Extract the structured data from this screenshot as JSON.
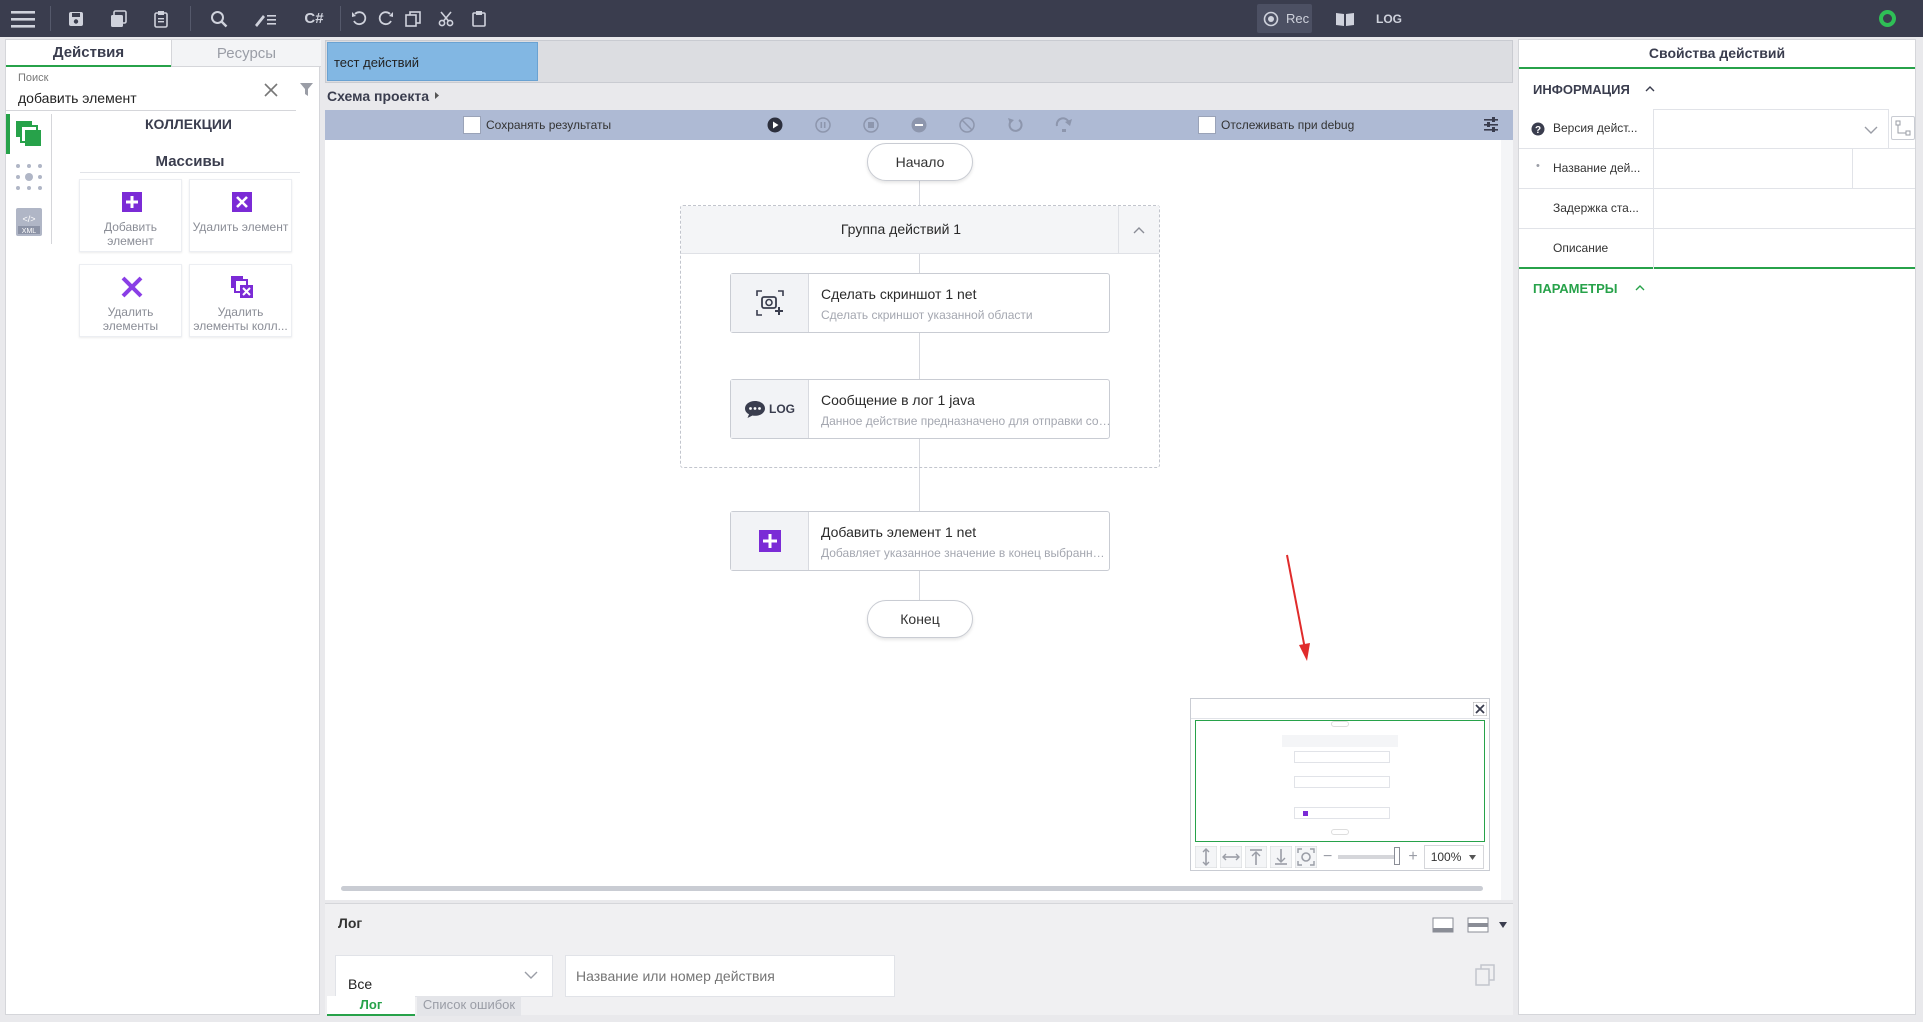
{
  "toolbar": {
    "rec_label": "Rec",
    "log_label": "LOG",
    "csharp_label": "C#"
  },
  "left": {
    "tabs": [
      "Действия",
      "Ресурсы"
    ],
    "search": {
      "label": "Поиск",
      "value": "добавить элемент"
    },
    "section_title": "КОЛЛЕКЦИИ",
    "subsection_title": "Массивы",
    "cards": [
      {
        "label": "Добавить элемент",
        "icon": "add-element-icon"
      },
      {
        "label": "Удалить элемент",
        "icon": "remove-element-icon"
      },
      {
        "label": "Удалить элементы",
        "icon": "remove-elements-icon"
      },
      {
        "label": "Удалить элементы колл...",
        "icon": "remove-collection-elements-icon"
      }
    ]
  },
  "center": {
    "tab_name": "тест действий",
    "breadcrumb": "Схема проекта",
    "save_results_label": "Сохранять результаты",
    "debug_label": "Отслеживать при debug",
    "start_label": "Начало",
    "end_label": "Конец",
    "group_title": "Группа действий  1",
    "actions": [
      {
        "title": "Сделать скриншот  1  net",
        "desc": "Сделать скриншот указанной области",
        "icon": "screenshot-icon"
      },
      {
        "title": "Сообщение в лог  1  java",
        "desc": "Данное действие предназначено для отправки сообщения в лог",
        "icon": "log-message-icon",
        "icon_text": "LOG"
      },
      {
        "title": "Добавить элемент  1  net",
        "desc": "Добавляет указанное значение в конец выбранного массива",
        "icon": "add-element-icon"
      }
    ],
    "minimap": {
      "zoom": "100%"
    }
  },
  "right": {
    "title": "Свойства действий",
    "info_section": "ИНФОРМАЦИЯ",
    "params_section": "ПАРАМЕТРЫ",
    "rows": [
      {
        "label": "Версия дейст..."
      },
      {
        "label": "Название дей..."
      },
      {
        "label": "Задержка ста..."
      },
      {
        "label": "Описание"
      }
    ]
  },
  "log": {
    "title": "Лог",
    "filter_value": "Все",
    "search_placeholder": "Название или номер действия",
    "tabs": [
      "Лог",
      "Список ошибок"
    ]
  },
  "colors": {
    "accent_purple": "#7b2bd6",
    "accent_green": "#27a24a",
    "tab_blue": "#82b7e3"
  }
}
